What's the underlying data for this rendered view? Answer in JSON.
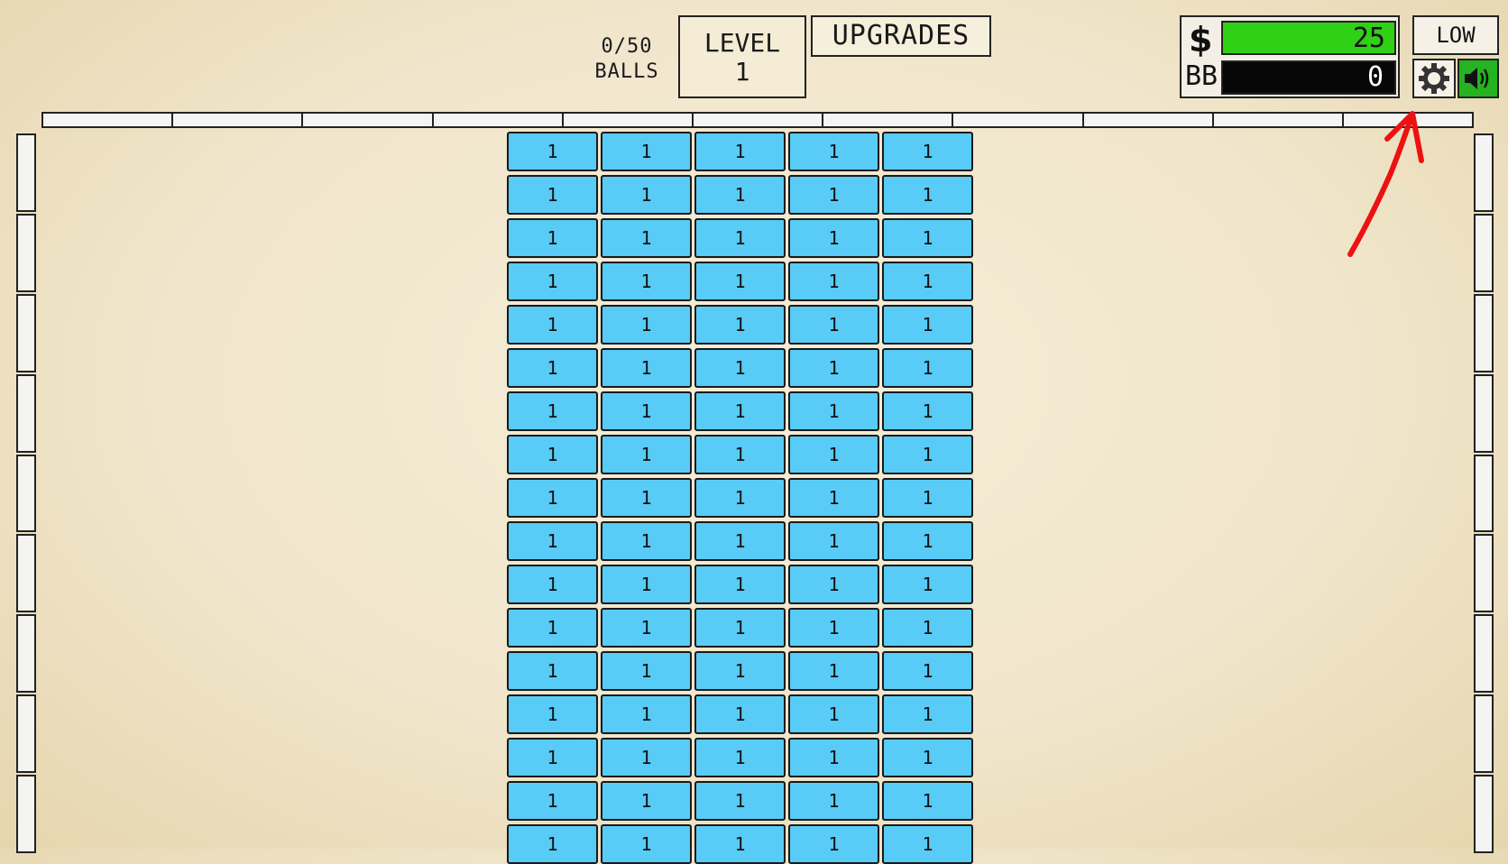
{
  "hud": {
    "balls_count": "0/50",
    "balls_label": "BALLS",
    "level_label": "LEVEL",
    "level_value": "1",
    "upgrades_label": "UPGRADES",
    "money_symbol": "$",
    "money_value": "25",
    "bb_label": "BB",
    "bb_value": "0",
    "quality_label": "LOW",
    "settings_icon": "gear-icon",
    "sound_icon": "speaker-icon"
  },
  "colors": {
    "brick": "#58cbf6",
    "money_bar": "#2fd016",
    "bb_bar": "#070707",
    "sound_button": "#25b321",
    "annotation_arrow": "#ee1111"
  },
  "board": {
    "brick_rows": 17,
    "brick_columns": 5,
    "brick_value": "1"
  }
}
